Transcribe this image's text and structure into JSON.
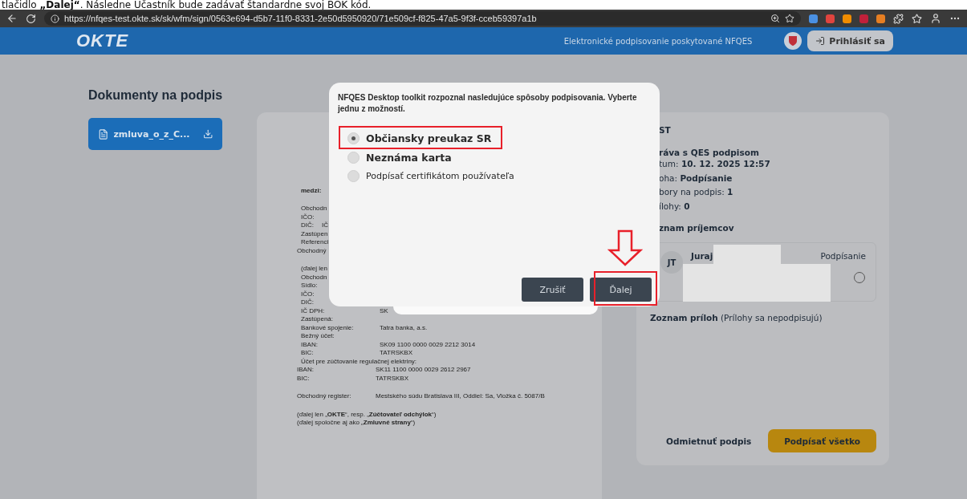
{
  "document_strip": {
    "text": "tlačidlo **„Ďalej“**. Následne Účastník bude zadávať štandardne svoj BOK kód."
  },
  "browser": {
    "url": "https://nfqes-test.okte.sk/sk/wfm/sign/0563e694-d5b7-11f0-8331-2e50d5950920/71e509cf-f825-47a5-9f3f-cceb59397a1b"
  },
  "header": {
    "logo": "OKTE",
    "tagline": "Elektronické podpisovanie poskytované NFQES",
    "login_button": "Prihlásiť sa"
  },
  "sidebar": {
    "title": "Dokumenty na podpis",
    "documents": [
      {
        "name": "zmluva_o_z_C...",
        "selected": true
      }
    ]
  },
  "document": {
    "blocks": [
      {
        "lines": [
          {
            "kind": "indented",
            "label": "medzi:",
            "bold": true
          }
        ]
      },
      {
        "lines": [
          {
            "kind": "indented",
            "label": "Obchodn"
          },
          {
            "kind": "indented",
            "label": "IČO:"
          },
          {
            "kind": "indented",
            "label": "DIČ:",
            "note": "IČ"
          },
          {
            "kind": "indented",
            "label": "Zastúpen"
          },
          {
            "kind": "indented",
            "label": "Referenci"
          },
          {
            "kind": "flush",
            "label": "Obchodný"
          }
        ]
      },
      {
        "lines": [
          {
            "kind": "indented",
            "label": "(ďalej len"
          },
          {
            "kind": "indented",
            "label": "Obchodn"
          },
          {
            "kind": "indented",
            "label": "Sídlo:"
          },
          {
            "kind": "indented",
            "label": "IČO:"
          },
          {
            "kind": "indented",
            "label": "DIČ:"
          },
          {
            "kind": "indented",
            "label": "IČ DPH:",
            "value": "SK"
          },
          {
            "kind": "indented",
            "label": "Zastúpená:"
          },
          {
            "kind": "indented",
            "label": "Bankové spojenie:",
            "value": "Tatra banka, a.s."
          },
          {
            "kind": "indented",
            "label": "Bežný účet:"
          },
          {
            "kind": "indented",
            "label": "IBAN:",
            "value": "SK09 1100 0000 0029 2212 3014"
          },
          {
            "kind": "indented",
            "label": "BIC:",
            "value": "TATRSKBX"
          },
          {
            "kind": "indented",
            "label": "Účet pre zúčtovanie regulačnej elektriny:"
          },
          {
            "kind": "flush",
            "label": "IBAN:",
            "value": "SK11 1100 0000 0029 2612 2967"
          },
          {
            "kind": "flush",
            "label": "BIC:",
            "value": "TATRSKBX"
          }
        ]
      },
      {
        "lines": [
          {
            "kind": "flush",
            "label": "Obchodný register:",
            "value": "Mestského súdu Bratislava III, Oddiel: Sa, Vložka č. 5087/B"
          }
        ]
      },
      {
        "lines": [
          {
            "kind": "flush",
            "label": "(ďalej len „**OKTE**“, resp. „**Zúčtovateľ odchýlok**“)"
          },
          {
            "kind": "flush",
            "label": "(ďalej spoločne aj ako „**Zmluvné strany**“)"
          }
        ]
      }
    ]
  },
  "details": {
    "title": "ST",
    "subtitle": "ráva s QES podpisom",
    "rows": [
      "tum: **10. 12. 2025 12:57**",
      "oha: **Podpísanie**",
      "bory na podpis: **1**",
      "ílohy: **0**"
    ],
    "recipients_title": "znam príjemcov",
    "recipients": [
      {
        "initials": "JT",
        "name": "Juraj",
        "status": "Podpísanie",
        "checked": false
      }
    ],
    "attachments_title": "**Zoznam príloh** (Prílohy sa nepodpisujú)",
    "reject_button": "Odmietnuť podpis",
    "sign_all_button": "Podpísať všetko"
  },
  "dialog": {
    "message": "NFQES Desktop toolkit rozpoznal nasledujúce spôsoby podpisovania. Vyberte jednu z možností.",
    "options": [
      {
        "label": "Občiansky preukaz SR",
        "selected": true,
        "emphasis": true
      },
      {
        "label": "Neznáma karta",
        "selected": false,
        "emphasis": true
      },
      {
        "label": "Podpísať certifikátom používateľa",
        "selected": false,
        "emphasis": false
      }
    ],
    "cancel_button": "Zrušiť",
    "next_button": "Ďalej"
  }
}
